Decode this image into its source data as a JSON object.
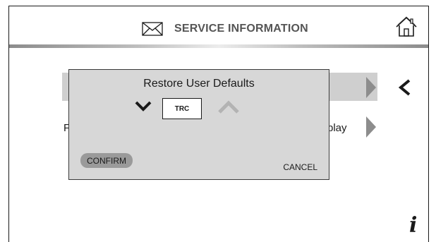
{
  "header": {
    "title": "SERVICE INFORMATION",
    "mail_icon": "envelope-icon",
    "home_icon": "home-icon"
  },
  "background": {
    "row2_left_text": "F",
    "row2_right_text": "play",
    "back_icon": "chevron-left-icon",
    "info_icon": "info-icon",
    "info_glyph": "i"
  },
  "dialog": {
    "title": "Restore User Defaults",
    "value": "TRC",
    "decrement_icon": "chevron-down-icon",
    "increment_icon": "chevron-up-icon",
    "confirm_label": "CONFIRM",
    "cancel_label": "CANCEL"
  },
  "colors": {
    "dialog_bg": "#d7d7d7",
    "confirm_bg": "#9a9a9a",
    "arrow": "#8d8d8d",
    "row_highlight": "#cfcfcf"
  }
}
